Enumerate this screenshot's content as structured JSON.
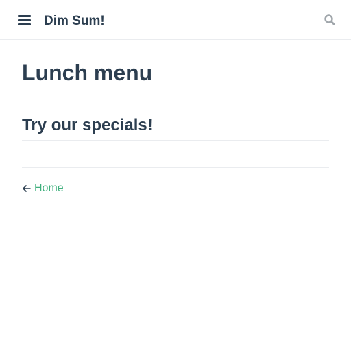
{
  "navbar": {
    "site_name": "Dim Sum!",
    "menu_icon": "hamburger-menu-icon",
    "search_icon": "search-icon"
  },
  "page": {
    "title": "Lunch menu",
    "section_heading": "Try our specials!",
    "prev_link": {
      "arrow": "arrow-left-icon",
      "label": "Home"
    }
  },
  "colors": {
    "text": "#2c3e50",
    "accent": "#3eaf7c",
    "border": "#eaecef",
    "icon_muted": "#a0a6ab"
  }
}
